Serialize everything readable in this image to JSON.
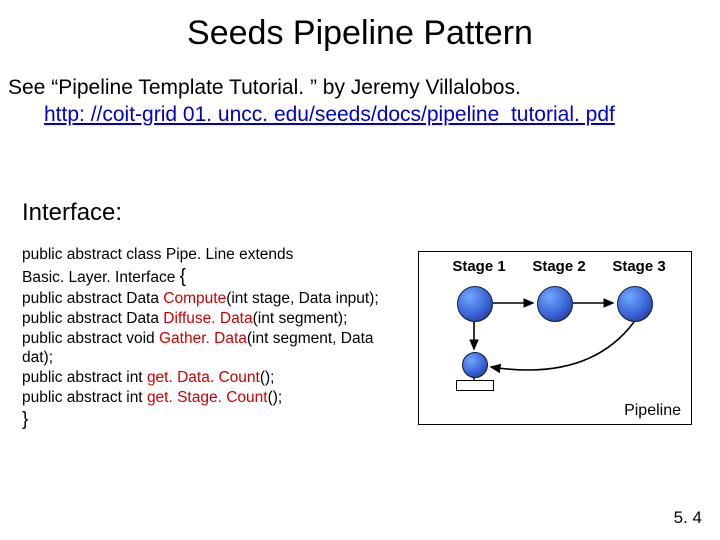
{
  "title": "Seeds Pipeline Pattern",
  "intro_line1": "See “Pipeline Template Tutorial. ” by Jeremy Villalobos.",
  "intro_link": "http: //coit-grid 01. uncc. edu/seeds/docs/pipeline_tutorial. pdf",
  "interface_heading": "Interface:",
  "code": {
    "l1": "public abstract class Pipe. Line extends",
    "l2a": "Basic. Layer. Interface ",
    "l2b": "{",
    "l3a": "public abstract Data ",
    "l3b": "Compute",
    "l3c": "(int stage, Data input);",
    "l4a": "public abstract Data ",
    "l4b": "Diffuse. Data",
    "l4c": "(int segment);",
    "l5a": "public abstract void ",
    "l5b": "Gather. Data",
    "l5c": "(int segment, Data",
    "l6": "dat);",
    "l7a": "public abstract int ",
    "l7b": "get. Data. Count",
    "l7c": "();",
    "l8a": "public abstract int ",
    "l8b": "get. Stage. Count",
    "l8c": "();",
    "l9": "}"
  },
  "diagram": {
    "stage1": "Stage 1",
    "stage2": "Stage 2",
    "stage3": "Stage 3",
    "caption": "Pipeline"
  },
  "pagenum": "5. 4"
}
